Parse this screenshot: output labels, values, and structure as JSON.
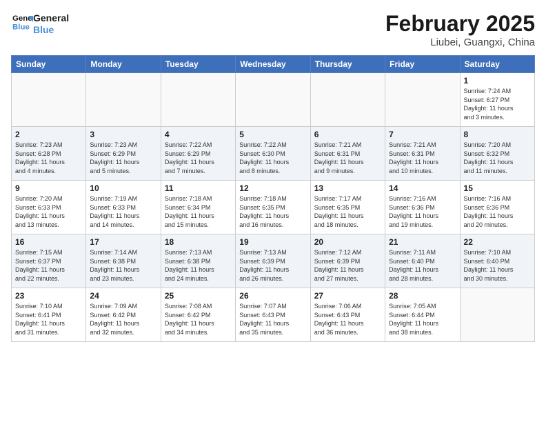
{
  "logo": {
    "line1": "General",
    "line2": "Blue"
  },
  "title": "February 2025",
  "location": "Liubei, Guangxi, China",
  "weekdays": [
    "Sunday",
    "Monday",
    "Tuesday",
    "Wednesday",
    "Thursday",
    "Friday",
    "Saturday"
  ],
  "weeks": [
    [
      {
        "day": "",
        "info": ""
      },
      {
        "day": "",
        "info": ""
      },
      {
        "day": "",
        "info": ""
      },
      {
        "day": "",
        "info": ""
      },
      {
        "day": "",
        "info": ""
      },
      {
        "day": "",
        "info": ""
      },
      {
        "day": "1",
        "info": "Sunrise: 7:24 AM\nSunset: 6:27 PM\nDaylight: 11 hours\nand 3 minutes."
      }
    ],
    [
      {
        "day": "2",
        "info": "Sunrise: 7:23 AM\nSunset: 6:28 PM\nDaylight: 11 hours\nand 4 minutes."
      },
      {
        "day": "3",
        "info": "Sunrise: 7:23 AM\nSunset: 6:29 PM\nDaylight: 11 hours\nand 5 minutes."
      },
      {
        "day": "4",
        "info": "Sunrise: 7:22 AM\nSunset: 6:29 PM\nDaylight: 11 hours\nand 7 minutes."
      },
      {
        "day": "5",
        "info": "Sunrise: 7:22 AM\nSunset: 6:30 PM\nDaylight: 11 hours\nand 8 minutes."
      },
      {
        "day": "6",
        "info": "Sunrise: 7:21 AM\nSunset: 6:31 PM\nDaylight: 11 hours\nand 9 minutes."
      },
      {
        "day": "7",
        "info": "Sunrise: 7:21 AM\nSunset: 6:31 PM\nDaylight: 11 hours\nand 10 minutes."
      },
      {
        "day": "8",
        "info": "Sunrise: 7:20 AM\nSunset: 6:32 PM\nDaylight: 11 hours\nand 11 minutes."
      }
    ],
    [
      {
        "day": "9",
        "info": "Sunrise: 7:20 AM\nSunset: 6:33 PM\nDaylight: 11 hours\nand 13 minutes."
      },
      {
        "day": "10",
        "info": "Sunrise: 7:19 AM\nSunset: 6:33 PM\nDaylight: 11 hours\nand 14 minutes."
      },
      {
        "day": "11",
        "info": "Sunrise: 7:18 AM\nSunset: 6:34 PM\nDaylight: 11 hours\nand 15 minutes."
      },
      {
        "day": "12",
        "info": "Sunrise: 7:18 AM\nSunset: 6:35 PM\nDaylight: 11 hours\nand 16 minutes."
      },
      {
        "day": "13",
        "info": "Sunrise: 7:17 AM\nSunset: 6:35 PM\nDaylight: 11 hours\nand 18 minutes."
      },
      {
        "day": "14",
        "info": "Sunrise: 7:16 AM\nSunset: 6:36 PM\nDaylight: 11 hours\nand 19 minutes."
      },
      {
        "day": "15",
        "info": "Sunrise: 7:16 AM\nSunset: 6:36 PM\nDaylight: 11 hours\nand 20 minutes."
      }
    ],
    [
      {
        "day": "16",
        "info": "Sunrise: 7:15 AM\nSunset: 6:37 PM\nDaylight: 11 hours\nand 22 minutes."
      },
      {
        "day": "17",
        "info": "Sunrise: 7:14 AM\nSunset: 6:38 PM\nDaylight: 11 hours\nand 23 minutes."
      },
      {
        "day": "18",
        "info": "Sunrise: 7:13 AM\nSunset: 6:38 PM\nDaylight: 11 hours\nand 24 minutes."
      },
      {
        "day": "19",
        "info": "Sunrise: 7:13 AM\nSunset: 6:39 PM\nDaylight: 11 hours\nand 26 minutes."
      },
      {
        "day": "20",
        "info": "Sunrise: 7:12 AM\nSunset: 6:39 PM\nDaylight: 11 hours\nand 27 minutes."
      },
      {
        "day": "21",
        "info": "Sunrise: 7:11 AM\nSunset: 6:40 PM\nDaylight: 11 hours\nand 28 minutes."
      },
      {
        "day": "22",
        "info": "Sunrise: 7:10 AM\nSunset: 6:40 PM\nDaylight: 11 hours\nand 30 minutes."
      }
    ],
    [
      {
        "day": "23",
        "info": "Sunrise: 7:10 AM\nSunset: 6:41 PM\nDaylight: 11 hours\nand 31 minutes."
      },
      {
        "day": "24",
        "info": "Sunrise: 7:09 AM\nSunset: 6:42 PM\nDaylight: 11 hours\nand 32 minutes."
      },
      {
        "day": "25",
        "info": "Sunrise: 7:08 AM\nSunset: 6:42 PM\nDaylight: 11 hours\nand 34 minutes."
      },
      {
        "day": "26",
        "info": "Sunrise: 7:07 AM\nSunset: 6:43 PM\nDaylight: 11 hours\nand 35 minutes."
      },
      {
        "day": "27",
        "info": "Sunrise: 7:06 AM\nSunset: 6:43 PM\nDaylight: 11 hours\nand 36 minutes."
      },
      {
        "day": "28",
        "info": "Sunrise: 7:05 AM\nSunset: 6:44 PM\nDaylight: 11 hours\nand 38 minutes."
      },
      {
        "day": "",
        "info": ""
      }
    ]
  ]
}
